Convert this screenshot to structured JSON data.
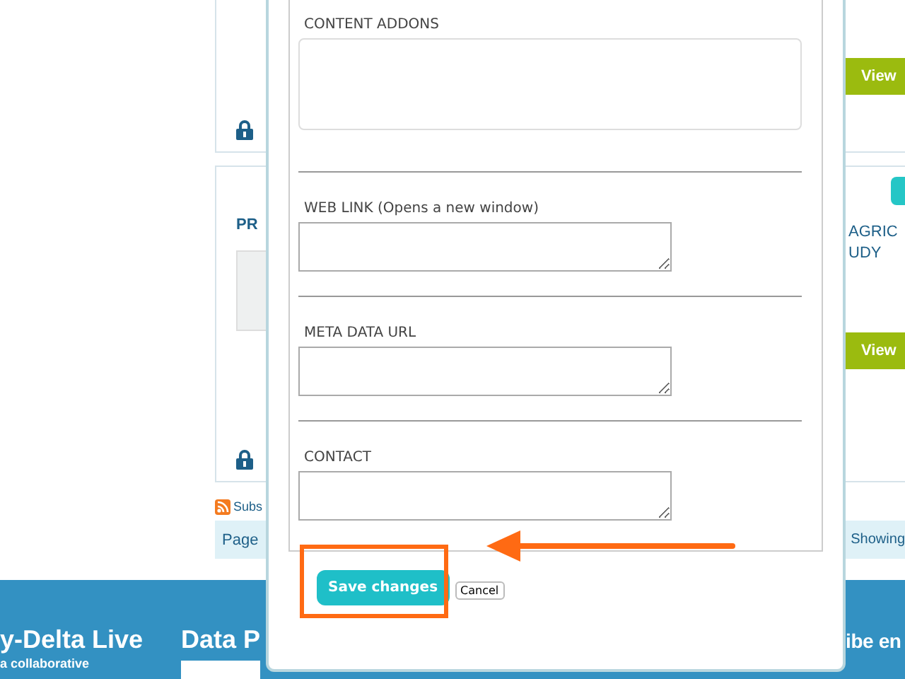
{
  "background": {
    "cards": [
      {
        "locked": true,
        "view_button": "View",
        "badge": false,
        "thumbnail": false
      },
      {
        "title": "PR",
        "side_title_lines": [
          "AGRIC",
          "UDY"
        ],
        "locked": true,
        "view_button": "View",
        "badge": true,
        "thumbnail": true
      }
    ],
    "subscribe": "Subs",
    "pager": {
      "left": "Page",
      "right": "Showing"
    }
  },
  "footer": {
    "columns": [
      {
        "heading": "y-Delta Live",
        "text": "a collaborative"
      },
      {
        "heading": "Data P",
        "text": null
      },
      {
        "heading": "ibe en",
        "text": null
      }
    ]
  },
  "dialog": {
    "fields": [
      {
        "label": "CONTENT ADDONS",
        "kind": "large"
      },
      {
        "label": "WEB LINK (Opens a new window)",
        "kind": "small"
      },
      {
        "label": "META DATA URL",
        "kind": "small"
      },
      {
        "label": "CONTACT",
        "kind": "small"
      }
    ],
    "buttons": [
      {
        "label": "Save changes",
        "kind": "primary",
        "highlighted": true
      },
      {
        "label": "Cancel",
        "kind": "plain",
        "highlighted": false
      }
    ]
  }
}
